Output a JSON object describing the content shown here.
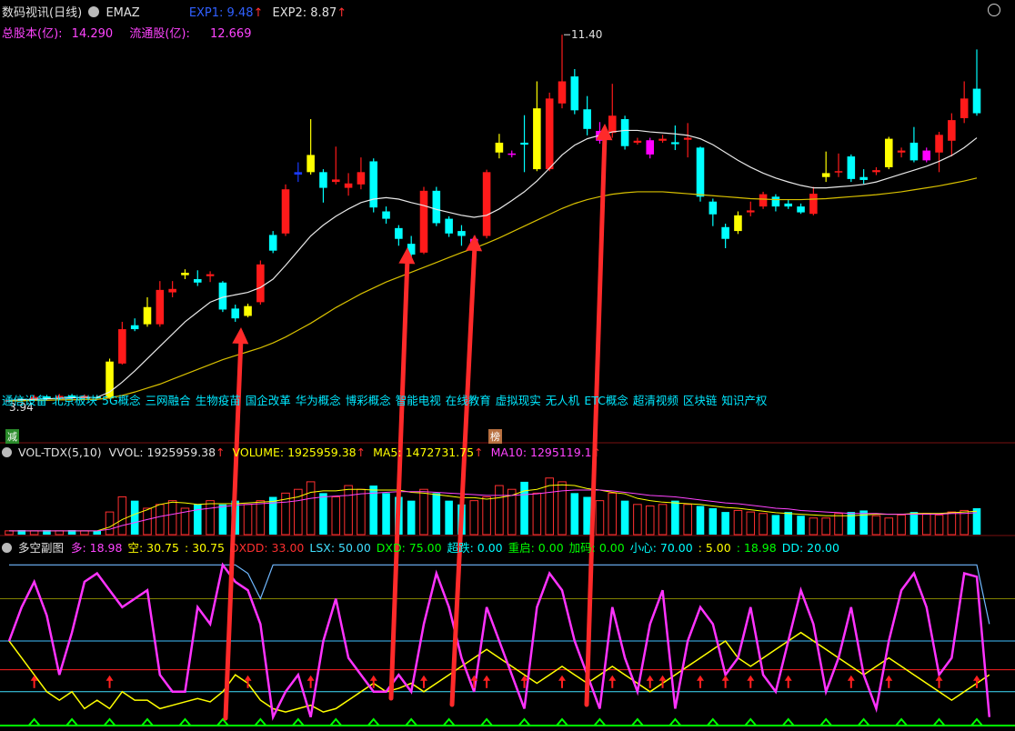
{
  "header": {
    "title": "数码视讯(日线)",
    "indicator": "EMAZ",
    "exp1": "EXP1: 9.48",
    "exp2": "EXP2: 8.87",
    "total_shares_label": "总股本(亿):",
    "total_shares_value": "14.290",
    "float_shares_label": "流通股(亿):",
    "float_shares_value": "12.669"
  },
  "concepts": [
    "通信设备",
    "北京板块",
    "5G概念",
    "三网融合",
    "生物疫苗",
    "国企改革",
    "华为概念",
    "博彩概念",
    "智能电视",
    "在线教育",
    "虚拟现实",
    "无人机",
    "ETC概念",
    "超清视频",
    "区块链",
    "知识产权"
  ],
  "badges": {
    "reduce": "减",
    "list": "榜"
  },
  "volume_header": {
    "name": "VOL-TDX(5,10)",
    "vvol": "VVOL: 1925959.38",
    "volume": "VOLUME: 1925959.38",
    "ma5": "MA5: 1472731.75",
    "ma10": "MA10: 1295119.1"
  },
  "indicator_header": {
    "name": "多空副图",
    "items": [
      {
        "text": "多: 18.98",
        "color": "#ff44ff"
      },
      {
        "text": "空: 30.75",
        "color": "#ffff00"
      },
      {
        "text": ": 30.75",
        "color": "#ffff00"
      },
      {
        "text": "DXDD: 33.00",
        "color": "#ff3030"
      },
      {
        "text": "LSX: 50.00",
        "color": "#40e0ff"
      },
      {
        "text": "DXD: 75.00",
        "color": "#00ff00"
      },
      {
        "text": "超跌: 0.00",
        "color": "#00ffff"
      },
      {
        "text": "重启: 0.00",
        "color": "#00ff00"
      },
      {
        "text": "加码: 0.00",
        "color": "#00ff00"
      },
      {
        "text": "小心: 70.00",
        "color": "#00ffff"
      },
      {
        "text": ": 5.00",
        "color": "#ffff00"
      },
      {
        "text": ": 18.98",
        "color": "#00ff00"
      },
      {
        "text": "DD: 20.00",
        "color": "#00ffff"
      }
    ]
  },
  "chart_data": {
    "type": "candlestick",
    "price_range": [
      3.4,
      11.7
    ],
    "high_label": "11.40",
    "low_label": "3.94",
    "candles": [
      {
        "o": 3.92,
        "c": 3.96,
        "h": 4.02,
        "l": 3.9,
        "col": "red"
      },
      {
        "o": 3.98,
        "c": 3.94,
        "h": 4.02,
        "l": 3.92,
        "col": "cyan"
      },
      {
        "o": 3.96,
        "c": 4.02,
        "h": 4.06,
        "l": 3.94,
        "col": "red"
      },
      {
        "o": 4.03,
        "c": 3.98,
        "h": 4.06,
        "l": 3.96,
        "col": "cyan"
      },
      {
        "o": 3.99,
        "c": 4.04,
        "h": 4.08,
        "l": 3.97,
        "col": "red"
      },
      {
        "o": 4.05,
        "c": 4.01,
        "h": 4.08,
        "l": 3.99,
        "col": "cyan"
      },
      {
        "o": 4.0,
        "c": 4.04,
        "h": 4.07,
        "l": 3.98,
        "col": "red"
      },
      {
        "o": 4.02,
        "c": 4.0,
        "h": 4.06,
        "l": 3.98,
        "col": "cyan"
      },
      {
        "o": 3.99,
        "c": 4.74,
        "h": 4.8,
        "l": 3.98,
        "col": "yellow"
      },
      {
        "o": 4.7,
        "c": 5.4,
        "h": 5.55,
        "l": 4.68,
        "col": "red"
      },
      {
        "o": 5.4,
        "c": 5.48,
        "h": 5.62,
        "l": 5.36,
        "col": "cyan"
      },
      {
        "o": 5.5,
        "c": 5.85,
        "h": 6.05,
        "l": 5.45,
        "col": "yellow"
      },
      {
        "o": 5.5,
        "c": 6.2,
        "h": 6.38,
        "l": 5.45,
        "col": "red"
      },
      {
        "o": 6.15,
        "c": 6.22,
        "h": 6.38,
        "l": 6.05,
        "col": "red"
      },
      {
        "o": 6.5,
        "c": 6.55,
        "h": 6.62,
        "l": 6.42,
        "col": "yellow"
      },
      {
        "o": 6.42,
        "c": 6.35,
        "h": 6.6,
        "l": 6.28,
        "col": "cyan"
      },
      {
        "o": 6.48,
        "c": 6.52,
        "h": 6.58,
        "l": 6.36,
        "col": "red"
      },
      {
        "o": 6.35,
        "c": 5.8,
        "h": 6.38,
        "l": 5.75,
        "col": "cyan"
      },
      {
        "o": 5.82,
        "c": 5.62,
        "h": 5.9,
        "l": 5.55,
        "col": "cyan"
      },
      {
        "o": 5.67,
        "c": 5.87,
        "h": 5.92,
        "l": 5.64,
        "col": "yellow"
      },
      {
        "o": 5.95,
        "c": 6.72,
        "h": 6.8,
        "l": 5.9,
        "col": "red"
      },
      {
        "o": 7.0,
        "c": 7.32,
        "h": 7.4,
        "l": 6.95,
        "col": "cyan"
      },
      {
        "o": 7.35,
        "c": 8.25,
        "h": 8.35,
        "l": 7.3,
        "col": "red"
      },
      {
        "o": 8.6,
        "c": 8.55,
        "h": 8.8,
        "l": 8.4,
        "col": "blue"
      },
      {
        "o": 8.6,
        "c": 8.95,
        "h": 9.68,
        "l": 8.55,
        "col": "yellow"
      },
      {
        "o": 8.6,
        "c": 8.28,
        "h": 8.66,
        "l": 7.98,
        "col": "cyan"
      },
      {
        "o": 8.45,
        "c": 8.4,
        "h": 9.12,
        "l": 8.35,
        "col": "red"
      },
      {
        "o": 8.37,
        "c": 8.28,
        "h": 8.58,
        "l": 8.12,
        "col": "red"
      },
      {
        "o": 8.35,
        "c": 8.6,
        "h": 8.9,
        "l": 8.25,
        "col": "red"
      },
      {
        "o": 8.82,
        "c": 7.88,
        "h": 8.88,
        "l": 7.78,
        "col": "cyan"
      },
      {
        "o": 7.8,
        "c": 7.65,
        "h": 7.9,
        "l": 7.55,
        "col": "cyan"
      },
      {
        "o": 7.46,
        "c": 7.24,
        "h": 7.52,
        "l": 7.1,
        "col": "cyan"
      },
      {
        "o": 7.14,
        "c": 6.92,
        "h": 7.3,
        "l": 6.85,
        "col": "cyan"
      },
      {
        "o": 6.96,
        "c": 8.22,
        "h": 8.3,
        "l": 6.93,
        "col": "red"
      },
      {
        "o": 8.22,
        "c": 7.56,
        "h": 8.3,
        "l": 7.5,
        "col": "cyan"
      },
      {
        "o": 7.65,
        "c": 7.35,
        "h": 7.7,
        "l": 7.28,
        "col": "cyan"
      },
      {
        "o": 7.4,
        "c": 7.3,
        "h": 7.52,
        "l": 7.1,
        "col": "cyan"
      },
      {
        "o": 7.24,
        "c": 7.1,
        "h": 7.3,
        "l": 7.02,
        "col": "magenta"
      },
      {
        "o": 7.3,
        "c": 8.6,
        "h": 8.65,
        "l": 7.25,
        "col": "red"
      },
      {
        "o": 9.0,
        "c": 9.2,
        "h": 9.38,
        "l": 8.88,
        "col": "yellow"
      },
      {
        "o": 8.98,
        "c": 8.96,
        "h": 9.04,
        "l": 8.9,
        "col": "magenta"
      },
      {
        "o": 9.2,
        "c": 9.16,
        "h": 9.76,
        "l": 8.6,
        "col": "cyan"
      },
      {
        "o": 8.66,
        "c": 9.9,
        "h": 10.45,
        "l": 8.62,
        "col": "yellow"
      },
      {
        "o": 8.66,
        "c": 10.1,
        "h": 10.22,
        "l": 8.62,
        "col": "red"
      },
      {
        "o": 10.0,
        "c": 10.45,
        "h": 11.4,
        "l": 9.9,
        "col": "red"
      },
      {
        "o": 10.55,
        "c": 9.86,
        "h": 10.7,
        "l": 9.78,
        "col": "cyan"
      },
      {
        "o": 9.88,
        "c": 9.48,
        "h": 10.15,
        "l": 9.35,
        "col": "cyan"
      },
      {
        "o": 9.44,
        "c": 9.24,
        "h": 9.62,
        "l": 9.18,
        "col": "magenta"
      },
      {
        "o": 9.4,
        "c": 9.75,
        "h": 10.4,
        "l": 9.3,
        "col": "red"
      },
      {
        "o": 9.68,
        "c": 9.13,
        "h": 9.75,
        "l": 9.06,
        "col": "cyan"
      },
      {
        "o": 9.2,
        "c": 9.24,
        "h": 9.3,
        "l": 9.16,
        "col": "red"
      },
      {
        "o": 9.25,
        "c": 8.96,
        "h": 9.3,
        "l": 8.88,
        "col": "magenta"
      },
      {
        "o": 9.24,
        "c": 9.28,
        "h": 9.36,
        "l": 9.2,
        "col": "red"
      },
      {
        "o": 9.21,
        "c": 9.17,
        "h": 9.55,
        "l": 9.05,
        "col": "cyan"
      },
      {
        "o": 9.26,
        "c": 9.3,
        "h": 9.6,
        "l": 8.9,
        "col": "red"
      },
      {
        "o": 9.1,
        "c": 8.1,
        "h": 9.12,
        "l": 8.0,
        "col": "cyan"
      },
      {
        "o": 8.0,
        "c": 7.74,
        "h": 8.06,
        "l": 7.5,
        "col": "cyan"
      },
      {
        "o": 7.48,
        "c": 7.24,
        "h": 7.55,
        "l": 7.05,
        "col": "cyan"
      },
      {
        "o": 7.4,
        "c": 7.72,
        "h": 7.8,
        "l": 7.34,
        "col": "yellow"
      },
      {
        "o": 7.78,
        "c": 7.82,
        "h": 8.0,
        "l": 7.7,
        "col": "red"
      },
      {
        "o": 7.9,
        "c": 8.15,
        "h": 8.2,
        "l": 7.85,
        "col": "red"
      },
      {
        "o": 8.1,
        "c": 7.9,
        "h": 8.15,
        "l": 7.8,
        "col": "cyan"
      },
      {
        "o": 7.96,
        "c": 7.9,
        "h": 8.03,
        "l": 7.85,
        "col": "cyan"
      },
      {
        "o": 7.9,
        "c": 7.78,
        "h": 7.96,
        "l": 7.75,
        "col": "cyan"
      },
      {
        "o": 7.75,
        "c": 8.16,
        "h": 8.3,
        "l": 7.72,
        "col": "red"
      },
      {
        "o": 8.5,
        "c": 8.58,
        "h": 9.02,
        "l": 8.4,
        "col": "yellow"
      },
      {
        "o": 8.62,
        "c": 8.62,
        "h": 8.98,
        "l": 8.5,
        "col": "red"
      },
      {
        "o": 8.92,
        "c": 8.46,
        "h": 8.96,
        "l": 8.4,
        "col": "cyan"
      },
      {
        "o": 8.5,
        "c": 8.44,
        "h": 8.66,
        "l": 8.36,
        "col": "cyan"
      },
      {
        "o": 8.6,
        "c": 8.64,
        "h": 8.7,
        "l": 8.54,
        "col": "red"
      },
      {
        "o": 8.7,
        "c": 9.28,
        "h": 9.32,
        "l": 8.66,
        "col": "yellow"
      },
      {
        "o": 9.0,
        "c": 9.04,
        "h": 9.1,
        "l": 8.9,
        "col": "red"
      },
      {
        "o": 9.2,
        "c": 8.84,
        "h": 9.52,
        "l": 8.8,
        "col": "cyan"
      },
      {
        "o": 8.84,
        "c": 9.04,
        "h": 9.1,
        "l": 8.8,
        "col": "magenta"
      },
      {
        "o": 9.0,
        "c": 9.36,
        "h": 9.42,
        "l": 8.6,
        "col": "red"
      },
      {
        "o": 9.24,
        "c": 9.66,
        "h": 9.8,
        "l": 8.92,
        "col": "red"
      },
      {
        "o": 9.7,
        "c": 10.1,
        "h": 10.45,
        "l": 9.6,
        "col": "red"
      },
      {
        "o": 10.3,
        "c": 9.8,
        "h": 11.1,
        "l": 9.75,
        "col": "cyan"
      }
    ],
    "ma_short": [
      3.95,
      3.96,
      3.97,
      3.98,
      3.99,
      4.0,
      4.01,
      4.01,
      4.12,
      4.32,
      4.55,
      4.8,
      5.05,
      5.3,
      5.55,
      5.75,
      5.95,
      6.05,
      6.1,
      6.15,
      6.25,
      6.42,
      6.7,
      7.0,
      7.3,
      7.52,
      7.7,
      7.85,
      7.98,
      8.05,
      8.08,
      8.05,
      7.98,
      7.92,
      7.84,
      7.78,
      7.72,
      7.68,
      7.72,
      7.85,
      8.02,
      8.2,
      8.42,
      8.68,
      8.95,
      9.15,
      9.28,
      9.35,
      9.42,
      9.45,
      9.45,
      9.42,
      9.4,
      9.38,
      9.35,
      9.28,
      9.16,
      9.0,
      8.84,
      8.7,
      8.58,
      8.48,
      8.4,
      8.33,
      8.28,
      8.28,
      8.3,
      8.32,
      8.35,
      8.4,
      8.48,
      8.56,
      8.64,
      8.72,
      8.82,
      8.94,
      9.1,
      9.3
    ],
    "ma_long": [
      3.94,
      3.94,
      3.95,
      3.95,
      3.96,
      3.96,
      3.97,
      3.97,
      4.0,
      4.05,
      4.12,
      4.2,
      4.28,
      4.38,
      4.48,
      4.58,
      4.68,
      4.78,
      4.86,
      4.94,
      5.02,
      5.12,
      5.24,
      5.38,
      5.52,
      5.68,
      5.84,
      5.98,
      6.12,
      6.24,
      6.36,
      6.46,
      6.56,
      6.66,
      6.76,
      6.86,
      6.96,
      7.05,
      7.15,
      7.26,
      7.38,
      7.5,
      7.62,
      7.74,
      7.86,
      7.96,
      8.04,
      8.1,
      8.15,
      8.18,
      8.2,
      8.2,
      8.2,
      8.18,
      8.16,
      8.14,
      8.12,
      8.1,
      8.08,
      8.06,
      8.05,
      8.04,
      8.04,
      8.04,
      8.05,
      8.06,
      8.08,
      8.1,
      8.12,
      8.14,
      8.17,
      8.2,
      8.24,
      8.28,
      8.32,
      8.37,
      8.42,
      8.48
    ],
    "volume": [
      0.05,
      0.06,
      0.05,
      0.06,
      0.05,
      0.06,
      0.05,
      0.05,
      0.3,
      0.5,
      0.45,
      0.35,
      0.4,
      0.45,
      0.35,
      0.4,
      0.45,
      0.4,
      0.45,
      0.4,
      0.45,
      0.5,
      0.55,
      0.6,
      0.7,
      0.55,
      0.5,
      0.65,
      0.6,
      0.65,
      0.55,
      0.5,
      0.45,
      0.6,
      0.55,
      0.45,
      0.4,
      0.45,
      0.5,
      0.65,
      0.6,
      0.7,
      0.55,
      0.75,
      0.7,
      0.55,
      0.5,
      0.45,
      0.55,
      0.45,
      0.4,
      0.38,
      0.4,
      0.45,
      0.4,
      0.38,
      0.35,
      0.3,
      0.32,
      0.3,
      0.28,
      0.26,
      0.3,
      0.25,
      0.22,
      0.22,
      0.28,
      0.3,
      0.32,
      0.25,
      0.22,
      0.26,
      0.3,
      0.28,
      0.26,
      0.3,
      0.32,
      0.35
    ],
    "vol_ma5": [
      0.05,
      0.05,
      0.05,
      0.05,
      0.05,
      0.05,
      0.05,
      0.05,
      0.1,
      0.2,
      0.27,
      0.33,
      0.4,
      0.43,
      0.42,
      0.4,
      0.41,
      0.41,
      0.41,
      0.42,
      0.43,
      0.44,
      0.47,
      0.5,
      0.56,
      0.58,
      0.58,
      0.6,
      0.6,
      0.59,
      0.59,
      0.59,
      0.56,
      0.55,
      0.53,
      0.51,
      0.49,
      0.49,
      0.47,
      0.49,
      0.52,
      0.58,
      0.6,
      0.65,
      0.66,
      0.65,
      0.61,
      0.59,
      0.56,
      0.54,
      0.48,
      0.45,
      0.43,
      0.42,
      0.41,
      0.4,
      0.38,
      0.36,
      0.35,
      0.33,
      0.31,
      0.29,
      0.28,
      0.27,
      0.26,
      0.25,
      0.25,
      0.25,
      0.26,
      0.27,
      0.27,
      0.27,
      0.28,
      0.28,
      0.28,
      0.29,
      0.3,
      0.31
    ],
    "vol_ma10": [
      0.05,
      0.05,
      0.05,
      0.05,
      0.05,
      0.05,
      0.05,
      0.05,
      0.07,
      0.12,
      0.16,
      0.2,
      0.24,
      0.27,
      0.3,
      0.33,
      0.35,
      0.37,
      0.39,
      0.4,
      0.41,
      0.42,
      0.43,
      0.45,
      0.48,
      0.5,
      0.51,
      0.52,
      0.54,
      0.55,
      0.56,
      0.57,
      0.57,
      0.57,
      0.56,
      0.55,
      0.54,
      0.53,
      0.52,
      0.52,
      0.52,
      0.53,
      0.54,
      0.56,
      0.58,
      0.59,
      0.59,
      0.59,
      0.58,
      0.56,
      0.54,
      0.52,
      0.51,
      0.5,
      0.48,
      0.46,
      0.44,
      0.42,
      0.41,
      0.39,
      0.37,
      0.35,
      0.34,
      0.32,
      0.31,
      0.3,
      0.29,
      0.28,
      0.28,
      0.28,
      0.27,
      0.27,
      0.27,
      0.27,
      0.27,
      0.28,
      0.28,
      0.29
    ],
    "indicator_levels": [
      0,
      20,
      33,
      50,
      75
    ],
    "line_magenta": [
      50,
      70,
      85,
      65,
      30,
      55,
      85,
      90,
      80,
      70,
      75,
      80,
      30,
      20,
      20,
      70,
      60,
      95,
      85,
      80,
      60,
      5,
      20,
      30,
      5,
      50,
      75,
      40,
      30,
      20,
      20,
      30,
      20,
      60,
      90,
      70,
      40,
      20,
      70,
      50,
      30,
      10,
      70,
      90,
      80,
      50,
      30,
      10,
      70,
      40,
      20,
      60,
      80,
      10,
      50,
      70,
      60,
      30,
      40,
      70,
      30,
      20,
      50,
      80,
      60,
      20,
      40,
      70,
      30,
      10,
      50,
      80,
      90,
      70,
      30,
      40,
      90,
      88,
      5
    ],
    "line_yellow": [
      50,
      40,
      30,
      20,
      15,
      20,
      10,
      15,
      10,
      20,
      15,
      15,
      10,
      12,
      14,
      16,
      14,
      20,
      30,
      25,
      15,
      10,
      8,
      10,
      12,
      8,
      10,
      15,
      20,
      25,
      20,
      22,
      25,
      20,
      25,
      30,
      35,
      40,
      45,
      40,
      35,
      30,
      25,
      30,
      35,
      30,
      25,
      30,
      35,
      30,
      25,
      20,
      25,
      30,
      35,
      40,
      45,
      50,
      40,
      35,
      40,
      45,
      50,
      55,
      50,
      45,
      40,
      35,
      30,
      35,
      40,
      35,
      30,
      25,
      20,
      15,
      20,
      25,
      30
    ],
    "line_blue": [
      95,
      95,
      95,
      95,
      95,
      95,
      95,
      95,
      95,
      95,
      95,
      95,
      95,
      95,
      95,
      95,
      95,
      95,
      95,
      90,
      75,
      95,
      95,
      95,
      95,
      95,
      95,
      95,
      95,
      95,
      95,
      95,
      95,
      95,
      95,
      95,
      95,
      95,
      95,
      95,
      95,
      95,
      95,
      95,
      95,
      95,
      95,
      95,
      95,
      95,
      95,
      95,
      95,
      95,
      95,
      95,
      95,
      95,
      95,
      95,
      95,
      95,
      95,
      95,
      95,
      95,
      95,
      95,
      95,
      95,
      95,
      95,
      95,
      95,
      95,
      95,
      95,
      95,
      60
    ]
  }
}
